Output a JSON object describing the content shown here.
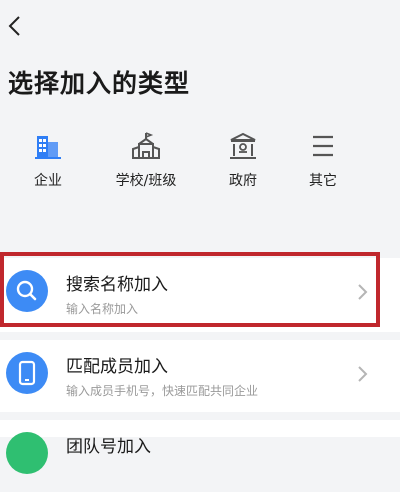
{
  "header": {
    "title": "选择加入的类型"
  },
  "types": [
    {
      "label": "企业",
      "icon": "building-icon",
      "color": "#2f7ef5"
    },
    {
      "label": "学校/班级",
      "icon": "school-icon",
      "color": "#555555"
    },
    {
      "label": "政府",
      "icon": "government-icon",
      "color": "#555555"
    },
    {
      "label": "其它",
      "icon": "menu-icon",
      "color": "#555555"
    }
  ],
  "options": [
    {
      "title": "搜索名称加入",
      "subtitle": "输入名称加入",
      "icon": "search-icon",
      "color": "#3d8bf5"
    },
    {
      "title": "匹配成员加入",
      "subtitle": "输入成员手机号，快速匹配共同企业",
      "icon": "phone-icon",
      "color": "#3d8bf5"
    },
    {
      "title": "团队号加入",
      "subtitle": "",
      "icon": "team-icon",
      "color": "#2fbf71"
    }
  ],
  "colors": {
    "accent": "#2f7ef5",
    "highlight_border": "#c0272d"
  }
}
